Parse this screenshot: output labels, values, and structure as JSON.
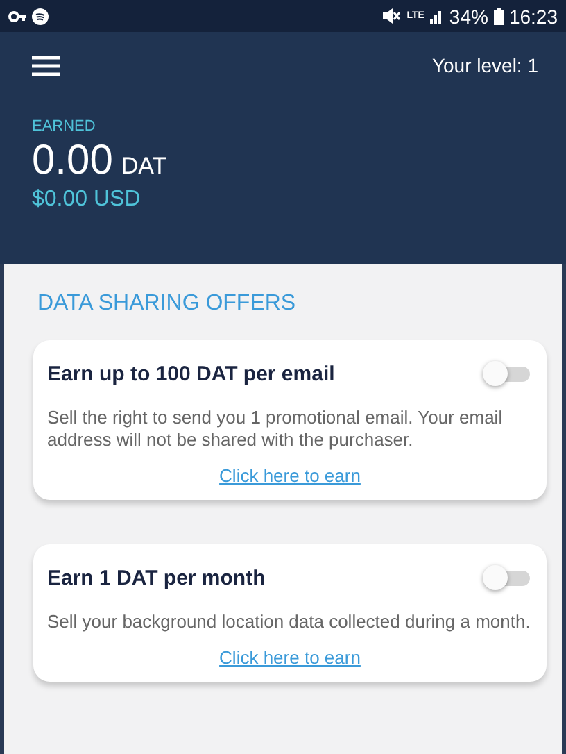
{
  "status_bar": {
    "network": "LTE",
    "battery": "34%",
    "time": "16:23"
  },
  "header": {
    "level": "Your level: 1",
    "earned_label": "EARNED",
    "amount": "0.00",
    "unit": "DAT",
    "usd": "$0.00 USD"
  },
  "section_title": "DATA SHARING OFFERS",
  "offers": [
    {
      "title": "Earn up to 100 DAT per email",
      "on": false,
      "description": "Sell the right to send you 1 promotional email. Your email address will not be shared with the purchaser.",
      "link": "Click here to earn"
    },
    {
      "title": "Earn 1 DAT per month",
      "on": false,
      "description": "Sell your background location data collected during a month.",
      "link": "Click here to earn"
    }
  ]
}
